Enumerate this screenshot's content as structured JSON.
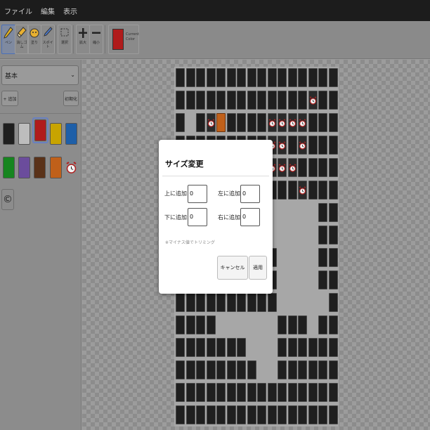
{
  "menu": [
    "ファイル",
    "編集",
    "表示"
  ],
  "toolbar": {
    "tools": [
      {
        "label": "ペン",
        "icon": "pencil-icon",
        "active": true
      },
      {
        "label": "消しゴム",
        "icon": "eraser-icon",
        "active": false
      },
      {
        "label": "塗り",
        "icon": "fill-bucket-icon",
        "active": false
      },
      {
        "label": "スポイト",
        "icon": "eyedropper-icon",
        "active": false
      },
      {
        "label": "選択",
        "icon": "select-icon",
        "active": false
      },
      {
        "label": "拡大",
        "icon": "zoom-in-icon",
        "active": false
      },
      {
        "label": "縮小",
        "icon": "zoom-out-icon",
        "active": false
      }
    ],
    "current_color_label": "Current Color",
    "current_color": "#b01b1b"
  },
  "sidebar": {
    "set_select": "基本",
    "add_label": "+ 追加",
    "init_label": "初期化",
    "palette": [
      {
        "name": "black",
        "color": "#1f1f1f"
      },
      {
        "name": "white",
        "color": "#bdbdbd"
      },
      {
        "name": "red",
        "color": "#b01b1b",
        "selected": true
      },
      {
        "name": "yellow",
        "color": "#c8a400"
      },
      {
        "name": "blue",
        "color": "#1e5fa8"
      },
      {
        "name": "green",
        "color": "#16851f"
      },
      {
        "name": "purple",
        "color": "#6b4c9c"
      },
      {
        "name": "brown",
        "color": "#5a3219"
      },
      {
        "name": "orange",
        "color": "#c0601a"
      },
      {
        "name": "clock",
        "icon": "alarm-clock-icon"
      }
    ],
    "copyright_symbol": "©"
  },
  "dialog": {
    "title": "サイズ変更",
    "top_label": "上に追加:",
    "top_value": "0",
    "left_label": "左に追加:",
    "left_value": "0",
    "bottom_label": "下に追加:",
    "bottom_value": "0",
    "right_label": "右に追加:",
    "right_value": "0",
    "note": "※マイナス値でトリミング",
    "cancel_label": "キャンセル",
    "apply_label": "適用"
  }
}
